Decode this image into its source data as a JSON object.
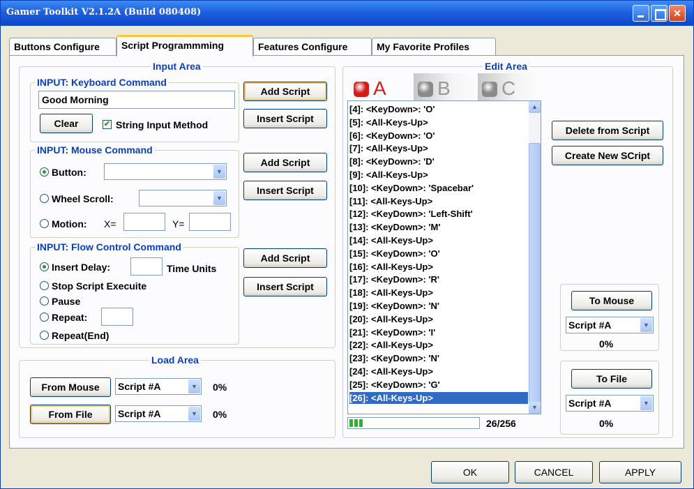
{
  "window": {
    "title": "Gamer Toolkit V2.1.2A (Build 080408)"
  },
  "tabs": [
    {
      "label": "Buttons Configure"
    },
    {
      "label": "Script Programmming"
    },
    {
      "label": "Features Configure"
    },
    {
      "label": "My Favorite Profiles"
    }
  ],
  "active_tab": "Script Programmming",
  "input_area": {
    "title": "Input Area",
    "keyboard": {
      "title": "INPUT: Keyboard Command",
      "value": "Good Morning",
      "clear_label": "Clear",
      "string_input_label": "String Input Method",
      "string_input_checked": true,
      "add_label": "Add Script",
      "insert_label": "Insert Script"
    },
    "mouse": {
      "title": "INPUT: Mouse Command",
      "button_label": "Button:",
      "button_value": "",
      "wheel_label": "Wheel Scroll:",
      "wheel_value": "",
      "motion_label": "Motion:",
      "x_label": "X=",
      "y_label": "Y=",
      "x_value": "",
      "y_value": "",
      "selected": "Button",
      "add_label": "Add Script",
      "insert_label": "Insert Script"
    },
    "flow": {
      "title": "INPUT: Flow Control Command",
      "insert_delay_label": "Insert Delay:",
      "time_units_label": "Time Units",
      "delay_value": "",
      "stop_label": "Stop Script Execuite",
      "pause_label": "Pause",
      "repeat_label": "Repeat:",
      "repeat_value": "",
      "repeat_end_label": "Repeat(End)",
      "selected": "Insert Delay",
      "add_label": "Add Script",
      "insert_label": "Insert Script"
    }
  },
  "load_area": {
    "title": "Load Area",
    "from_mouse_label": "From Mouse",
    "from_mouse_script": "Script #A",
    "from_mouse_pct": "0%",
    "from_file_label": "From File",
    "from_file_script": "Script #A",
    "from_file_pct": "0%"
  },
  "edit_area": {
    "title": "Edit Area",
    "slots": [
      {
        "letter": "A",
        "active": true,
        "led": "#d21b1b",
        "color": "#d21b1b"
      },
      {
        "letter": "B",
        "active": false,
        "led": "#8a8a8a",
        "color": "#9a9a9a"
      },
      {
        "letter": "C",
        "active": false,
        "led": "#8a8a8a",
        "color": "#9a9a9a"
      }
    ],
    "script_lines": [
      "[4]:  <KeyDown>: 'O'",
      "[5]:  <All-Keys-Up>",
      "[6]:  <KeyDown>: 'O'",
      "[7]:  <All-Keys-Up>",
      "[8]:  <KeyDown>: 'D'",
      "[9]:  <All-Keys-Up>",
      "[10]:  <KeyDown>: 'Spacebar'",
      "[11]:  <All-Keys-Up>",
      "[12]:  <KeyDown>: 'Left-Shift'",
      "[13]:  <KeyDown>: 'M'",
      "[14]:  <All-Keys-Up>",
      "[15]:  <KeyDown>: 'O'",
      "[16]:  <All-Keys-Up>",
      "[17]:  <KeyDown>: 'R'",
      "[18]:  <All-Keys-Up>",
      "[19]:  <KeyDown>: 'N'",
      "[20]:  <All-Keys-Up>",
      "[21]:  <KeyDown>: 'I'",
      "[22]:  <All-Keys-Up>",
      "[23]:  <KeyDown>: 'N'",
      "[24]:  <All-Keys-Up>",
      "[25]:  <KeyDown>: 'G'",
      "[26]:  <All-Keys-Up>"
    ],
    "selected_line": "[26]:  <All-Keys-Up>",
    "progress_fraction": 0.1016,
    "counter": "26/256",
    "delete_label": "Delete from Script",
    "create_label": "Create New SCript",
    "to_mouse_label": "To Mouse",
    "to_mouse_script": "Script #A",
    "to_mouse_pct": "0%",
    "to_file_label": "To File",
    "to_file_script": "Script #A",
    "to_file_pct": "0%"
  },
  "footer": {
    "ok_label": "OK",
    "cancel_label": "CANCEL",
    "apply_label": "APPLY"
  },
  "colors": {
    "accent": "#0a3fb8",
    "selection": "#316ac5",
    "tab_highlight": "#ffc83c",
    "progress": "#2fb12f"
  }
}
